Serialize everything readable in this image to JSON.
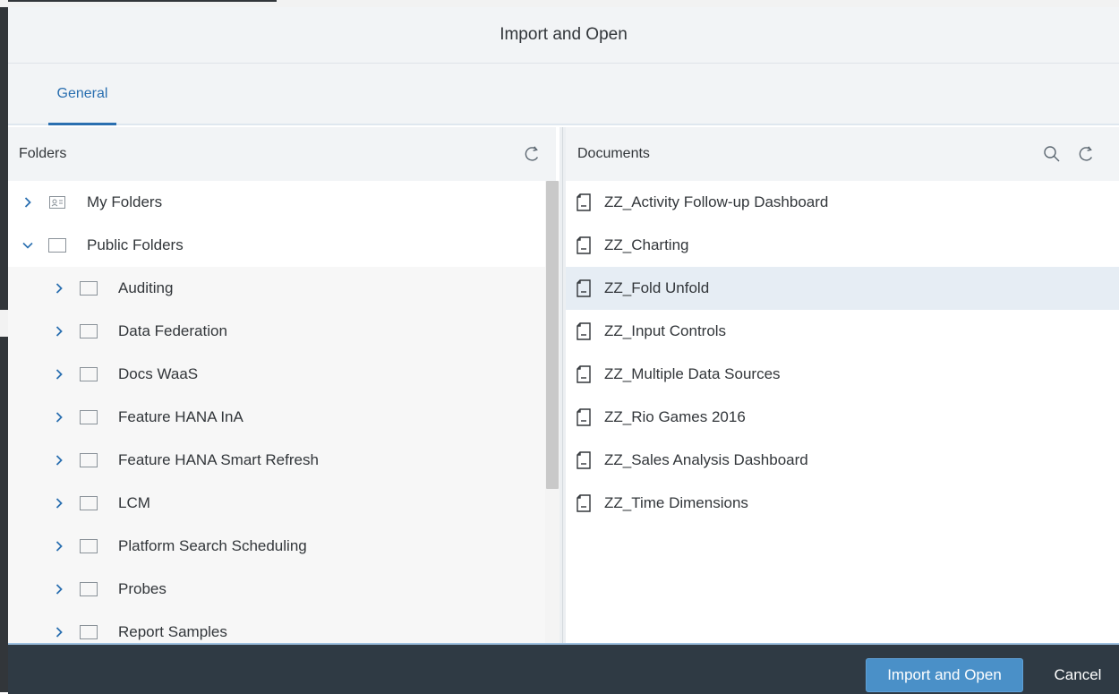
{
  "dialog": {
    "title": "Import and Open"
  },
  "tabs": [
    {
      "label": "General",
      "selected": true
    }
  ],
  "folders": {
    "header": "Folders",
    "refresh_icon": "refresh-icon",
    "items": [
      {
        "label": "My Folders",
        "icon": "personal-folder-icon",
        "expanded": false,
        "level": 0
      },
      {
        "label": "Public Folders",
        "icon": "folder-icon",
        "expanded": true,
        "level": 0
      },
      {
        "label": "Auditing",
        "icon": "folder-icon",
        "expanded": false,
        "level": 1
      },
      {
        "label": "Data Federation",
        "icon": "folder-icon",
        "expanded": false,
        "level": 1
      },
      {
        "label": "Docs WaaS",
        "icon": "folder-icon",
        "expanded": false,
        "level": 1
      },
      {
        "label": "Feature HANA InA",
        "icon": "folder-icon",
        "expanded": false,
        "level": 1
      },
      {
        "label": "Feature HANA Smart Refresh",
        "icon": "folder-icon",
        "expanded": false,
        "level": 1
      },
      {
        "label": "LCM",
        "icon": "folder-icon",
        "expanded": false,
        "level": 1
      },
      {
        "label": "Platform Search Scheduling",
        "icon": "folder-icon",
        "expanded": false,
        "level": 1
      },
      {
        "label": "Probes",
        "icon": "folder-icon",
        "expanded": false,
        "level": 1
      },
      {
        "label": "Report Samples",
        "icon": "folder-icon",
        "expanded": false,
        "level": 1
      }
    ]
  },
  "documents": {
    "header": "Documents",
    "search_icon": "search-icon",
    "refresh_icon": "refresh-icon",
    "items": [
      {
        "label": "ZZ_Activity Follow-up Dashboard",
        "selected": false
      },
      {
        "label": "ZZ_Charting",
        "selected": false
      },
      {
        "label": "ZZ_Fold Unfold",
        "selected": true
      },
      {
        "label": "ZZ_Input Controls",
        "selected": false
      },
      {
        "label": "ZZ_Multiple Data Sources",
        "selected": false
      },
      {
        "label": "ZZ_Rio Games 2016",
        "selected": false
      },
      {
        "label": "ZZ_Sales Analysis Dashboard",
        "selected": false
      },
      {
        "label": "ZZ_Time Dimensions",
        "selected": false
      }
    ]
  },
  "footer": {
    "primary_label": "Import and Open",
    "cancel_label": "Cancel"
  },
  "colors": {
    "accent": "#2a6fb0",
    "primary_button": "#4a90c8",
    "footer_bg": "#2f3a44",
    "selected_row": "#e6edf4"
  }
}
